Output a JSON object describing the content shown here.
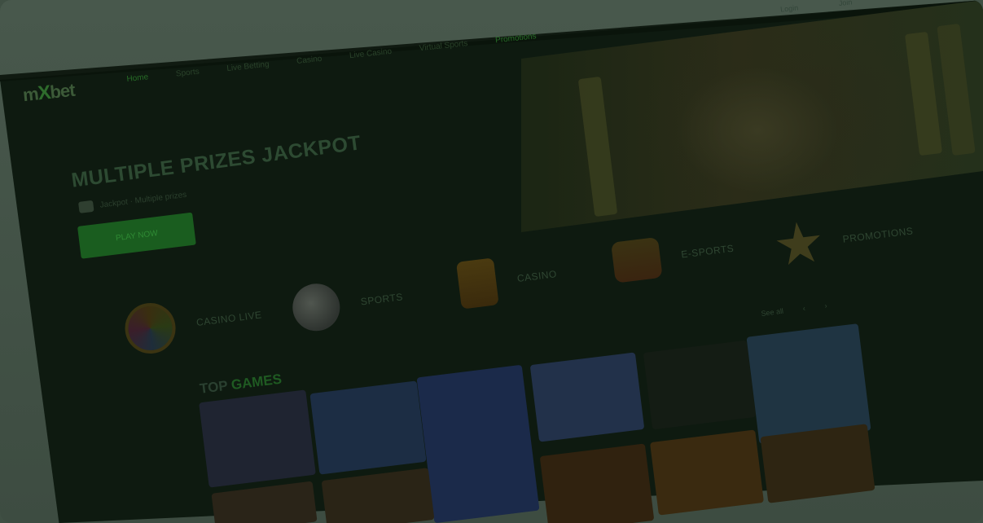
{
  "nav": {
    "logo_pre": "m",
    "logo_x": "X",
    "logo_post": "bet",
    "items": [
      {
        "label": "Home",
        "active": true
      },
      {
        "label": "Sports",
        "active": false
      },
      {
        "label": "Live Betting",
        "active": false
      },
      {
        "label": "Casino",
        "active": false
      },
      {
        "label": "Live Casino",
        "active": false
      },
      {
        "label": "Virtual Sports",
        "active": false
      },
      {
        "label": "Promotions",
        "active": false
      }
    ],
    "top_right": [
      "Login",
      "Join"
    ]
  },
  "hero": {
    "title": "MULTIPLE PRIZES JACKPOT",
    "subtitle": "Jackpot · Multiple prizes",
    "button": "PLAY NOW"
  },
  "categories": [
    {
      "label": "CASINO LIVE",
      "icon": "roulette-wheel-icon"
    },
    {
      "label": "SPORTS",
      "icon": "soccer-ball-icon"
    },
    {
      "label": "CASINO",
      "icon": "slot-machine-icon"
    },
    {
      "label": "E-SPORTS",
      "icon": "joystick-icon"
    },
    {
      "label": "PROMOTIONS",
      "icon": "star-icon"
    }
  ],
  "games": {
    "title_pre": "TOP",
    "title_post": "GAMES",
    "see_all": "See all",
    "tiles": [
      {
        "name": "game-tile-1",
        "color": "#1f2431"
      },
      {
        "name": "game-tile-2",
        "color": "#1c2d44"
      },
      {
        "name": "game-tile-3",
        "color": "#1b2a4a"
      },
      {
        "name": "game-tile-4",
        "color": "#22314a"
      },
      {
        "name": "game-tile-5",
        "color": "#141c14"
      },
      {
        "name": "game-tile-6",
        "color": "#1f3442"
      },
      {
        "name": "game-tile-7",
        "color": "#2a2418"
      },
      {
        "name": "game-tile-8",
        "color": "#2a2416"
      },
      {
        "name": "game-tile-9",
        "color": "#30220f"
      },
      {
        "name": "game-tile-10",
        "color": "#3a2a10"
      },
      {
        "name": "game-tile-11",
        "color": "#2e2512"
      }
    ]
  },
  "colors": {
    "brand_green": "#1f6d24",
    "background": "#0e1a10",
    "overlay": "#3f4f43"
  }
}
